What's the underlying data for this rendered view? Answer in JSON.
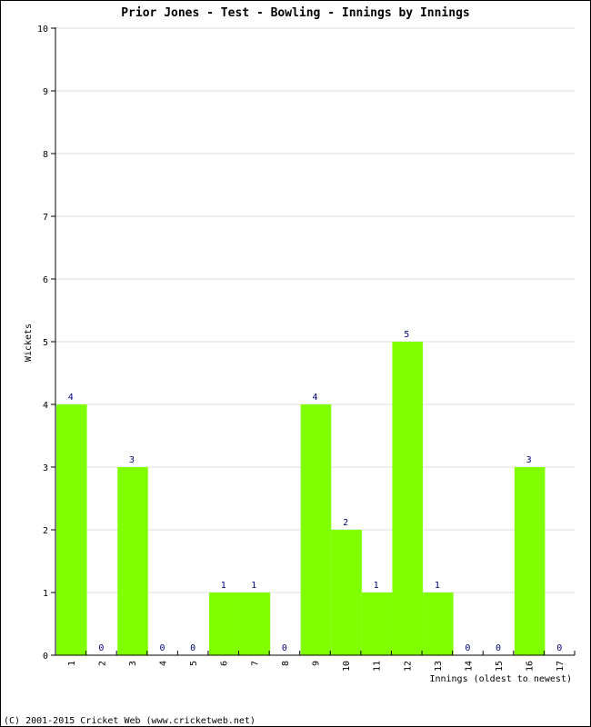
{
  "chart_data": {
    "type": "bar",
    "title": "Prior Jones - Test - Bowling - Innings by Innings",
    "xlabel": "Innings (oldest to newest)",
    "ylabel": "Wickets",
    "categories": [
      "1",
      "2",
      "3",
      "4",
      "5",
      "6",
      "7",
      "8",
      "9",
      "10",
      "11",
      "12",
      "13",
      "14",
      "15",
      "16",
      "17"
    ],
    "values": [
      4,
      0,
      3,
      0,
      0,
      1,
      1,
      0,
      4,
      2,
      1,
      5,
      1,
      0,
      0,
      3,
      0
    ],
    "ylim": [
      0,
      10
    ],
    "yticks": [
      0,
      1,
      2,
      3,
      4,
      5,
      6,
      7,
      8,
      9,
      10
    ],
    "grid": true,
    "legend": "none",
    "bar_color": "#80ff00",
    "label_color": "#000080",
    "grid_color": "#dddddd"
  },
  "footer": "(C) 2001-2015 Cricket Web (www.cricketweb.net)"
}
